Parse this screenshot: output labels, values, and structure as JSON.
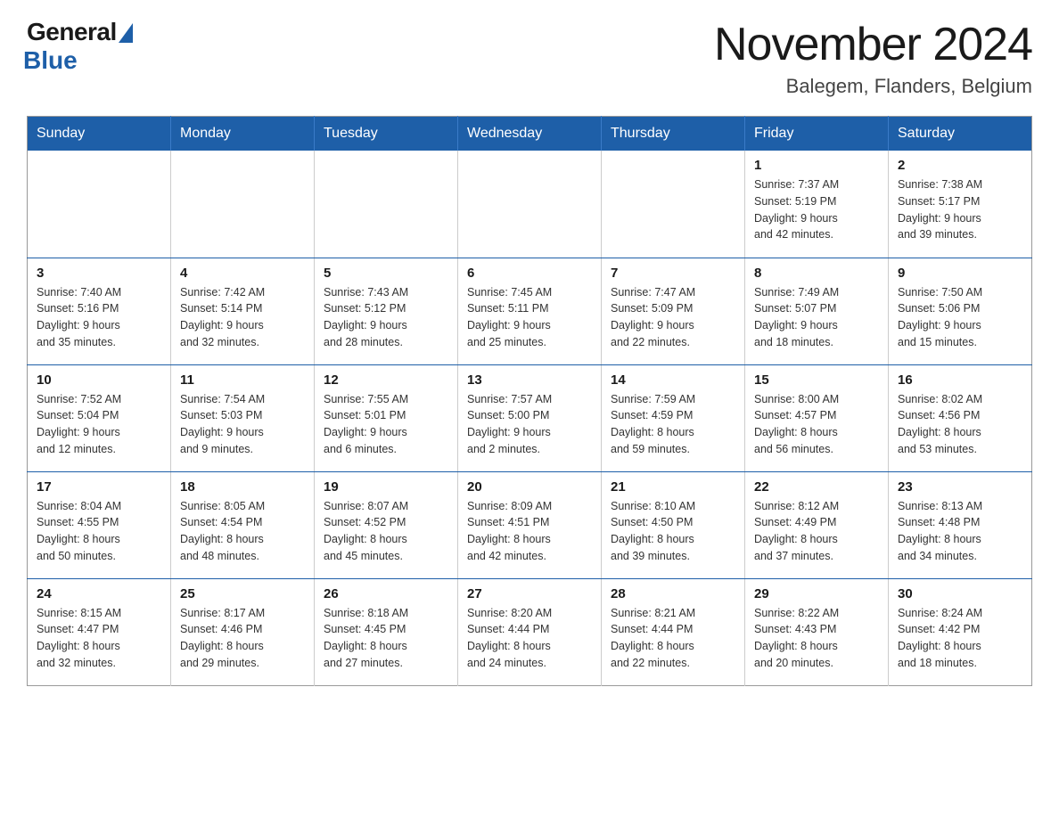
{
  "header": {
    "logo_general": "General",
    "logo_blue": "Blue",
    "month_title": "November 2024",
    "location": "Balegem, Flanders, Belgium"
  },
  "weekdays": [
    "Sunday",
    "Monday",
    "Tuesday",
    "Wednesday",
    "Thursday",
    "Friday",
    "Saturday"
  ],
  "weeks": [
    [
      {
        "day": "",
        "info": ""
      },
      {
        "day": "",
        "info": ""
      },
      {
        "day": "",
        "info": ""
      },
      {
        "day": "",
        "info": ""
      },
      {
        "day": "",
        "info": ""
      },
      {
        "day": "1",
        "info": "Sunrise: 7:37 AM\nSunset: 5:19 PM\nDaylight: 9 hours\nand 42 minutes."
      },
      {
        "day": "2",
        "info": "Sunrise: 7:38 AM\nSunset: 5:17 PM\nDaylight: 9 hours\nand 39 minutes."
      }
    ],
    [
      {
        "day": "3",
        "info": "Sunrise: 7:40 AM\nSunset: 5:16 PM\nDaylight: 9 hours\nand 35 minutes."
      },
      {
        "day": "4",
        "info": "Sunrise: 7:42 AM\nSunset: 5:14 PM\nDaylight: 9 hours\nand 32 minutes."
      },
      {
        "day": "5",
        "info": "Sunrise: 7:43 AM\nSunset: 5:12 PM\nDaylight: 9 hours\nand 28 minutes."
      },
      {
        "day": "6",
        "info": "Sunrise: 7:45 AM\nSunset: 5:11 PM\nDaylight: 9 hours\nand 25 minutes."
      },
      {
        "day": "7",
        "info": "Sunrise: 7:47 AM\nSunset: 5:09 PM\nDaylight: 9 hours\nand 22 minutes."
      },
      {
        "day": "8",
        "info": "Sunrise: 7:49 AM\nSunset: 5:07 PM\nDaylight: 9 hours\nand 18 minutes."
      },
      {
        "day": "9",
        "info": "Sunrise: 7:50 AM\nSunset: 5:06 PM\nDaylight: 9 hours\nand 15 minutes."
      }
    ],
    [
      {
        "day": "10",
        "info": "Sunrise: 7:52 AM\nSunset: 5:04 PM\nDaylight: 9 hours\nand 12 minutes."
      },
      {
        "day": "11",
        "info": "Sunrise: 7:54 AM\nSunset: 5:03 PM\nDaylight: 9 hours\nand 9 minutes."
      },
      {
        "day": "12",
        "info": "Sunrise: 7:55 AM\nSunset: 5:01 PM\nDaylight: 9 hours\nand 6 minutes."
      },
      {
        "day": "13",
        "info": "Sunrise: 7:57 AM\nSunset: 5:00 PM\nDaylight: 9 hours\nand 2 minutes."
      },
      {
        "day": "14",
        "info": "Sunrise: 7:59 AM\nSunset: 4:59 PM\nDaylight: 8 hours\nand 59 minutes."
      },
      {
        "day": "15",
        "info": "Sunrise: 8:00 AM\nSunset: 4:57 PM\nDaylight: 8 hours\nand 56 minutes."
      },
      {
        "day": "16",
        "info": "Sunrise: 8:02 AM\nSunset: 4:56 PM\nDaylight: 8 hours\nand 53 minutes."
      }
    ],
    [
      {
        "day": "17",
        "info": "Sunrise: 8:04 AM\nSunset: 4:55 PM\nDaylight: 8 hours\nand 50 minutes."
      },
      {
        "day": "18",
        "info": "Sunrise: 8:05 AM\nSunset: 4:54 PM\nDaylight: 8 hours\nand 48 minutes."
      },
      {
        "day": "19",
        "info": "Sunrise: 8:07 AM\nSunset: 4:52 PM\nDaylight: 8 hours\nand 45 minutes."
      },
      {
        "day": "20",
        "info": "Sunrise: 8:09 AM\nSunset: 4:51 PM\nDaylight: 8 hours\nand 42 minutes."
      },
      {
        "day": "21",
        "info": "Sunrise: 8:10 AM\nSunset: 4:50 PM\nDaylight: 8 hours\nand 39 minutes."
      },
      {
        "day": "22",
        "info": "Sunrise: 8:12 AM\nSunset: 4:49 PM\nDaylight: 8 hours\nand 37 minutes."
      },
      {
        "day": "23",
        "info": "Sunrise: 8:13 AM\nSunset: 4:48 PM\nDaylight: 8 hours\nand 34 minutes."
      }
    ],
    [
      {
        "day": "24",
        "info": "Sunrise: 8:15 AM\nSunset: 4:47 PM\nDaylight: 8 hours\nand 32 minutes."
      },
      {
        "day": "25",
        "info": "Sunrise: 8:17 AM\nSunset: 4:46 PM\nDaylight: 8 hours\nand 29 minutes."
      },
      {
        "day": "26",
        "info": "Sunrise: 8:18 AM\nSunset: 4:45 PM\nDaylight: 8 hours\nand 27 minutes."
      },
      {
        "day": "27",
        "info": "Sunrise: 8:20 AM\nSunset: 4:44 PM\nDaylight: 8 hours\nand 24 minutes."
      },
      {
        "day": "28",
        "info": "Sunrise: 8:21 AM\nSunset: 4:44 PM\nDaylight: 8 hours\nand 22 minutes."
      },
      {
        "day": "29",
        "info": "Sunrise: 8:22 AM\nSunset: 4:43 PM\nDaylight: 8 hours\nand 20 minutes."
      },
      {
        "day": "30",
        "info": "Sunrise: 8:24 AM\nSunset: 4:42 PM\nDaylight: 8 hours\nand 18 minutes."
      }
    ]
  ]
}
